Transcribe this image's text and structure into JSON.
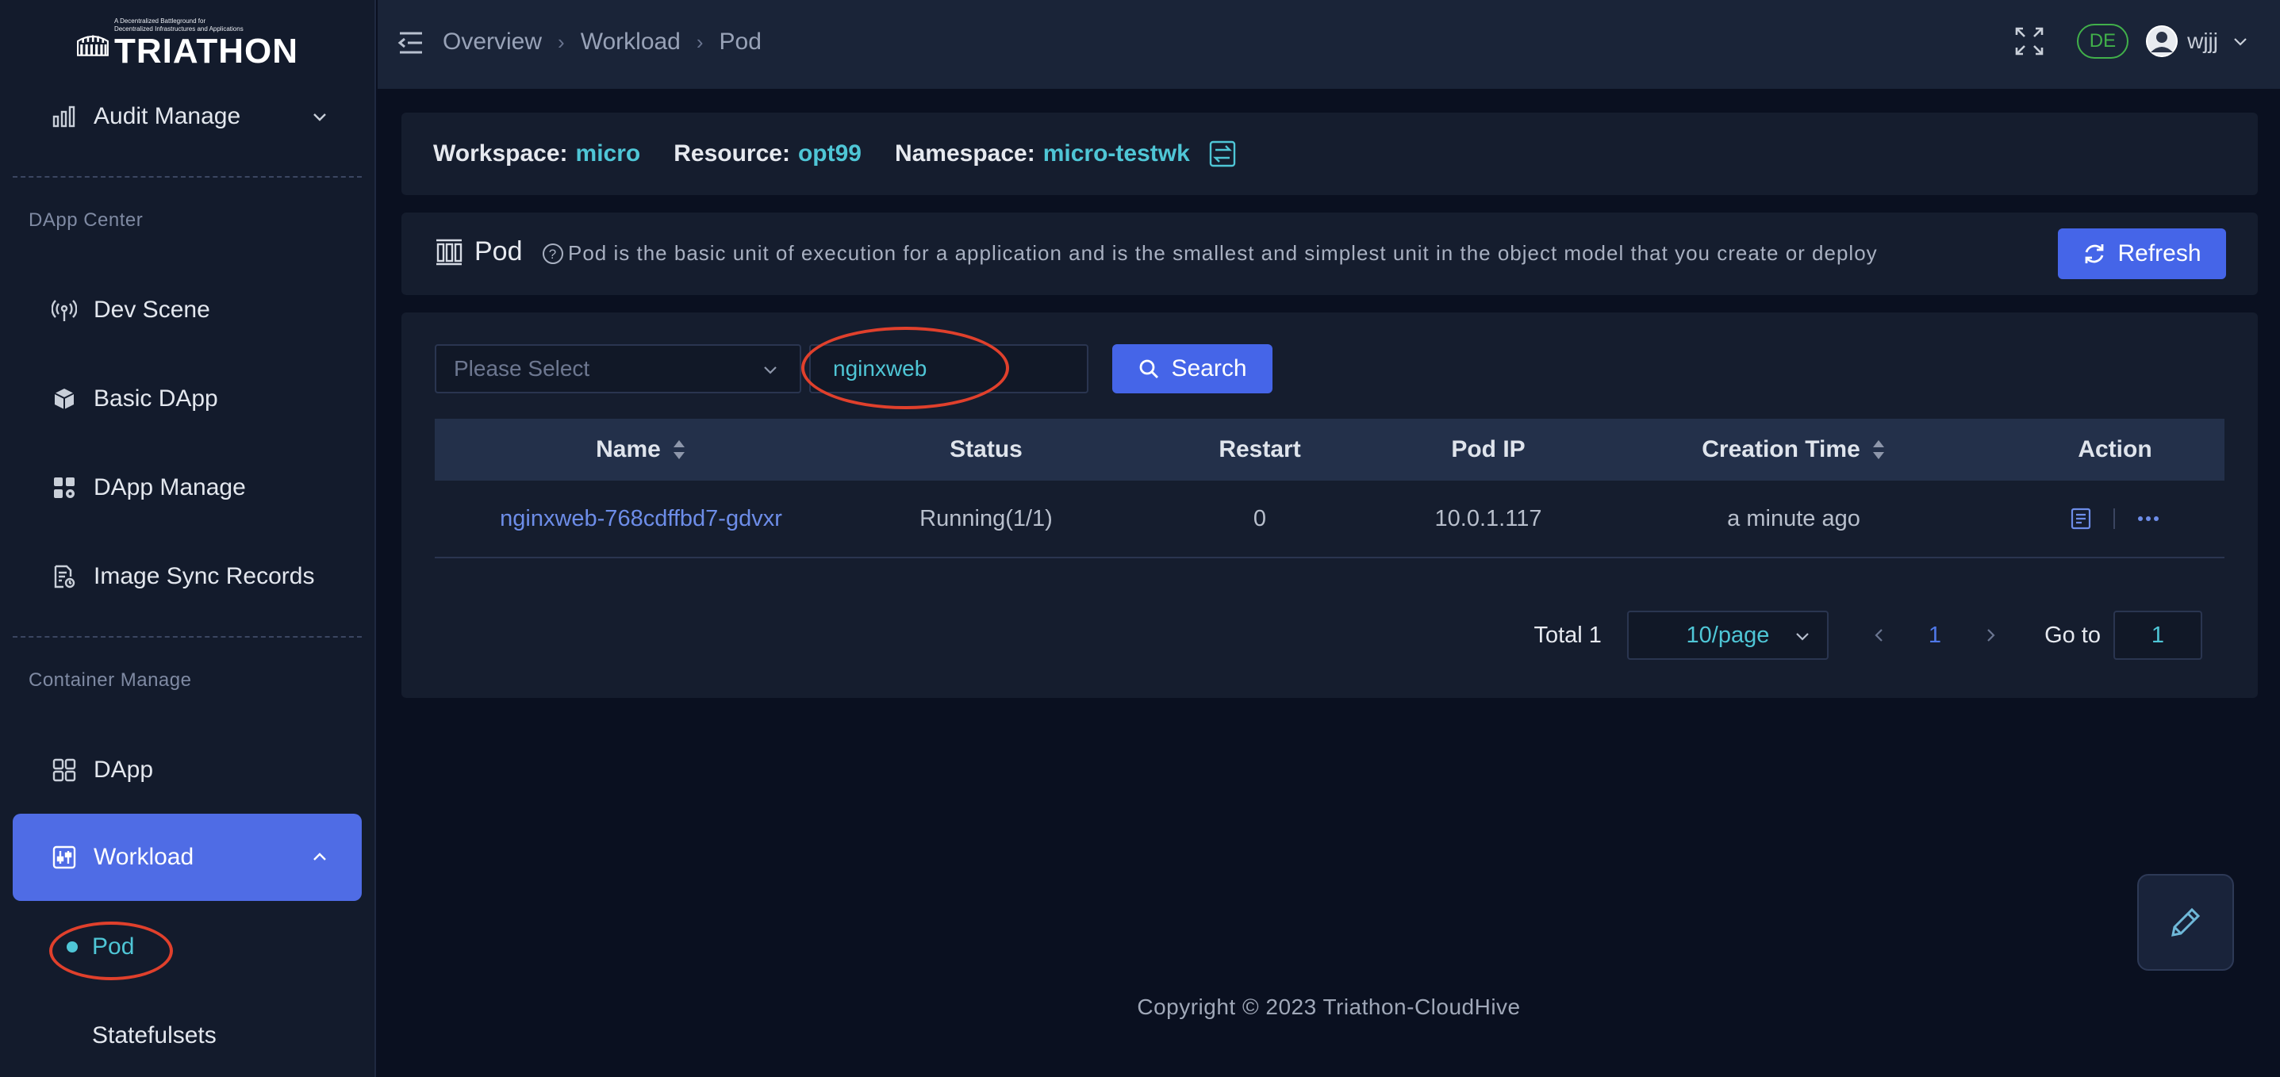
{
  "logo": {
    "tagline_1": "A Decentralized Battleground for",
    "tagline_2": "Decentralized Infrastructures and Applications",
    "word": "TRIATHON"
  },
  "sidebar": {
    "audit_label": "Audit Manage",
    "section_dapp_center": "DApp Center",
    "dev_scene": "Dev Scene",
    "basic_dapp": "Basic DApp",
    "dapp_manage": "DApp Manage",
    "image_sync": "Image Sync Records",
    "section_container": "Container Manage",
    "dapp": "DApp",
    "workload": "Workload",
    "pod": "Pod",
    "statefulsets": "Statefulsets"
  },
  "header": {
    "breadcrumbs": [
      "Overview",
      "Workload",
      "Pod"
    ],
    "lang": "DE",
    "user": "wjjj"
  },
  "workspace": {
    "workspace_label": "Workspace:",
    "workspace_value": "micro",
    "resource_label": "Resource:",
    "resource_value": "opt99",
    "namespace_label": "Namespace:",
    "namespace_value": "micro-testwk"
  },
  "pod_header": {
    "title": "Pod",
    "description": "Pod is the basic unit of execution for a application and is the smallest and simplest unit in the object model that you create or deploy",
    "refresh": "Refresh"
  },
  "filters": {
    "select_placeholder": "Please Select",
    "search_value": "nginxweb",
    "search_button": "Search"
  },
  "table": {
    "columns": [
      "Name",
      "Status",
      "Restart",
      "Pod IP",
      "Creation Time",
      "Action"
    ],
    "rows": [
      {
        "name": "nginxweb-768cdffbd7-gdvxr",
        "status": "Running(1/1)",
        "restart": "0",
        "pod_ip": "10.0.1.117",
        "creation": "a minute ago"
      }
    ]
  },
  "pagination": {
    "total": "Total 1",
    "page_size": "10/page",
    "current": "1",
    "goto_label": "Go to",
    "goto_value": "1"
  },
  "footer": "Copyright © 2023 Triathon-CloudHive",
  "colors": {
    "accent": "#4565e8",
    "teal": "#4fc6d6",
    "annotation": "#e0402c"
  }
}
